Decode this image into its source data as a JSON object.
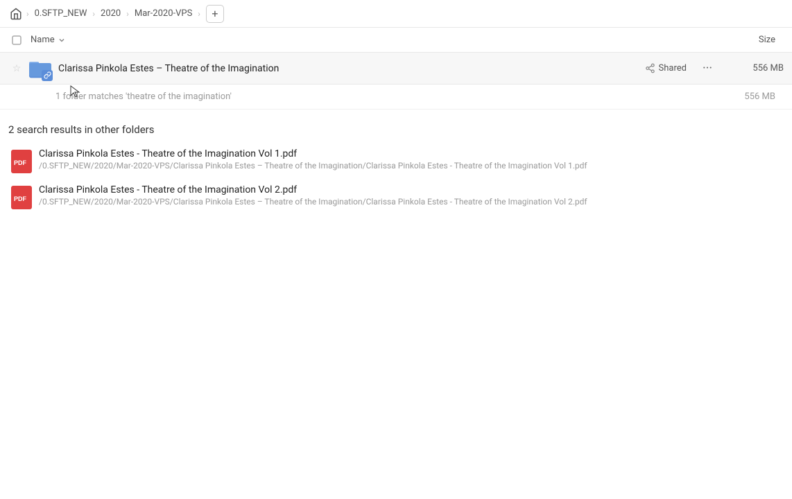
{
  "breadcrumb": {
    "home_icon": "🏠",
    "items": [
      "0.SFTP_NEW",
      "2020",
      "Mar-2020-VPS"
    ],
    "add_label": "+"
  },
  "columns": {
    "name_label": "Name",
    "size_label": "Size"
  },
  "folder": {
    "name": "Clarissa Pinkola Estes – Theatre of the Imagination",
    "shared_label": "Shared",
    "size": "556 MB"
  },
  "match_info": {
    "text": "1 folder matches 'theatre of the imagination'",
    "size": "556 MB"
  },
  "other_section": {
    "header": "2 search results in other folders"
  },
  "search_results": [
    {
      "filename": "Clarissa Pinkola Estes - Theatre of the Imagination Vol 1.pdf",
      "path": "/0.SFTP_NEW/2020/Mar-2020-VPS/Clarissa Pinkola Estes – Theatre of the Imagination/Clarissa Pinkola Estes - Theatre of the Imagination Vol 1.pdf"
    },
    {
      "filename": "Clarissa Pinkola Estes - Theatre of the Imagination Vol 2.pdf",
      "path": "/0.SFTP_NEW/2020/Mar-2020-VPS/Clarissa Pinkola Estes – Theatre of the Imagination/Clarissa Pinkola Estes - Theatre of the Imagination Vol 2.pdf"
    }
  ]
}
